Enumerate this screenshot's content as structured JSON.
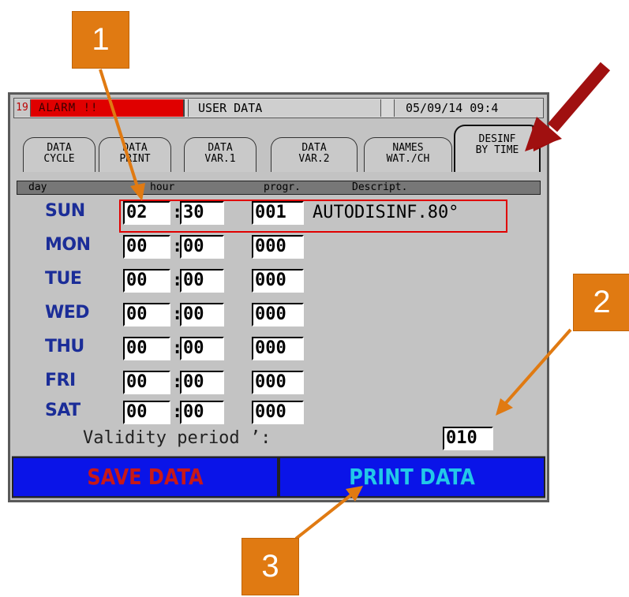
{
  "status": {
    "alarm_num": "19",
    "alarm_text": "ALARM !!",
    "title": "USER DATA",
    "datetime": "05/09/14  09:4"
  },
  "tabs": [
    {
      "line1": "DATA",
      "line2": "CYCLE"
    },
    {
      "line1": "DATA",
      "line2": "PRINT"
    },
    {
      "line1": "DATA",
      "line2": "VAR.1"
    },
    {
      "line1": "DATA",
      "line2": "VAR.2"
    },
    {
      "line1": "NAMES",
      "line2": "WAT./CH"
    },
    {
      "line1": "DESINF",
      "line2": "BY TIME"
    }
  ],
  "table_header": {
    "day": "day",
    "hour": "hour",
    "progr": "progr.",
    "descript": "Descript."
  },
  "rows": [
    {
      "day": "SUN",
      "hh": "02",
      "mm": "30",
      "prog": "001",
      "desc": "AUTODISINF.80°"
    },
    {
      "day": "MON",
      "hh": "00",
      "mm": "00",
      "prog": "000",
      "desc": ""
    },
    {
      "day": "TUE",
      "hh": "00",
      "mm": "00",
      "prog": "000",
      "desc": ""
    },
    {
      "day": "WED",
      "hh": "00",
      "mm": "00",
      "prog": "000",
      "desc": ""
    },
    {
      "day": "THU",
      "hh": "00",
      "mm": "00",
      "prog": "000",
      "desc": ""
    },
    {
      "day": "FRI",
      "hh": "00",
      "mm": "00",
      "prog": "000",
      "desc": ""
    },
    {
      "day": "SAT",
      "hh": "00",
      "mm": "00",
      "prog": "000",
      "desc": ""
    }
  ],
  "colon": ":",
  "validity": {
    "label": "Validity period ’:",
    "value": "010"
  },
  "buttons": {
    "save": "SAVE DATA",
    "print": "PRINT DATA"
  },
  "callouts": [
    "1",
    "2",
    "3"
  ],
  "colors": {
    "accent": "#e07a12",
    "arrow": "#a01010",
    "highlight": "#e00000",
    "button_bg": "#0a14e8"
  }
}
